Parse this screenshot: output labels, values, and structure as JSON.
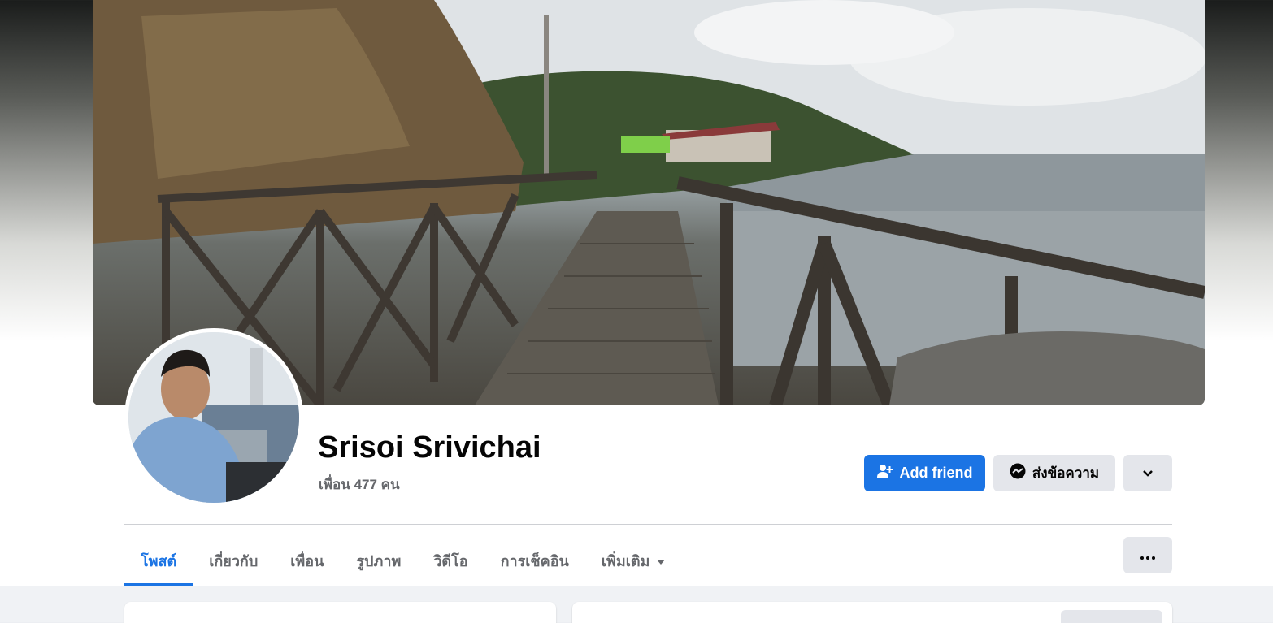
{
  "profile": {
    "name": "Srisoi Srivichai",
    "friends_text": "เพื่อน 477 คน"
  },
  "actions": {
    "add_friend": "Add friend",
    "message": "ส่งข้อความ"
  },
  "tabs": [
    {
      "label": "โพสต์",
      "active": true
    },
    {
      "label": "เกี่ยวกับ",
      "active": false
    },
    {
      "label": "เพื่อน",
      "active": false
    },
    {
      "label": "รูปภาพ",
      "active": false
    },
    {
      "label": "วิดีโอ",
      "active": false
    },
    {
      "label": "การเช็คอิน",
      "active": false
    },
    {
      "label": "เพิ่มเติม",
      "active": false
    }
  ],
  "colors": {
    "accent": "#1b74e4",
    "secondary_button": "#e4e6eb",
    "muted_text": "#65676b"
  },
  "icons": {
    "add_friend": "person-plus-icon",
    "message": "messenger-icon",
    "dropdown": "chevron-down-icon",
    "more_tab": "caret-down-icon",
    "overflow": "ellipsis-icon"
  }
}
